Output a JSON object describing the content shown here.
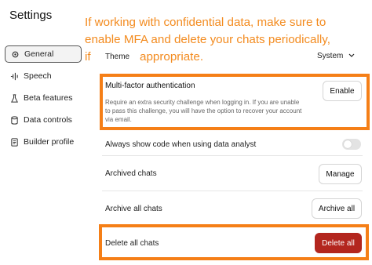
{
  "header": {
    "title": "Settings"
  },
  "sidebar": {
    "items": [
      {
        "label": "General",
        "icon": "gear-icon",
        "active": true
      },
      {
        "label": "Speech",
        "icon": "waveform-icon"
      },
      {
        "label": "Beta features",
        "icon": "flask-icon"
      },
      {
        "label": "Data controls",
        "icon": "database-icon"
      },
      {
        "label": "Builder profile",
        "icon": "id-card-icon"
      }
    ]
  },
  "annotation": {
    "line1": "If working with confidential data, make sure to",
    "line2": "enable MFA and delete your chats periodically,",
    "line3a": "if",
    "line3b": "appropriate."
  },
  "settings": {
    "theme": {
      "label": "Theme",
      "value": "System"
    },
    "mfa": {
      "title": "Multi-factor authentication",
      "description": "Require an extra security challenge when logging in. If you are unable to pass this challenge, you will have the option to recover your account via email.",
      "button": "Enable"
    },
    "code": {
      "label": "Always show code when using data analyst",
      "enabled": false
    },
    "archived": {
      "label": "Archived chats",
      "button": "Manage"
    },
    "archive_all": {
      "label": "Archive all chats",
      "button": "Archive all"
    },
    "delete_all": {
      "label": "Delete all chats",
      "button": "Delete all"
    }
  },
  "colors": {
    "annotation": "#f38b1f",
    "highlight_border": "#f57f17",
    "danger": "#b3261e"
  }
}
